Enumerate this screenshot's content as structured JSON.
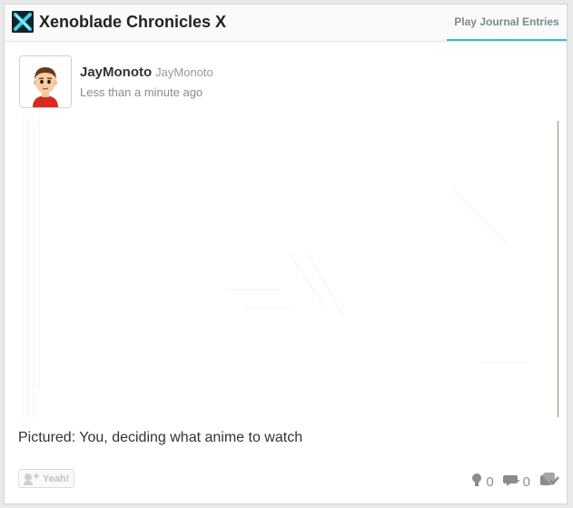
{
  "header": {
    "game_title": "Xenoblade Chronicles X",
    "game_icon": "xenoblade-x-logo-icon",
    "tab_label": "Play Journal Entries"
  },
  "post": {
    "user_name": "JayMonoto",
    "user_id": "JayMonoto",
    "timestamp": "Less than a minute ago",
    "avatar": "mii-avatar-icon",
    "body": "Pictured: You, deciding what anime to watch"
  },
  "actions": {
    "yeah_label": "Yeah!",
    "yeah_count": "0",
    "comment_count": "0"
  },
  "colors": {
    "accent": "#29c3d8",
    "muted": "#8c8c8c"
  }
}
